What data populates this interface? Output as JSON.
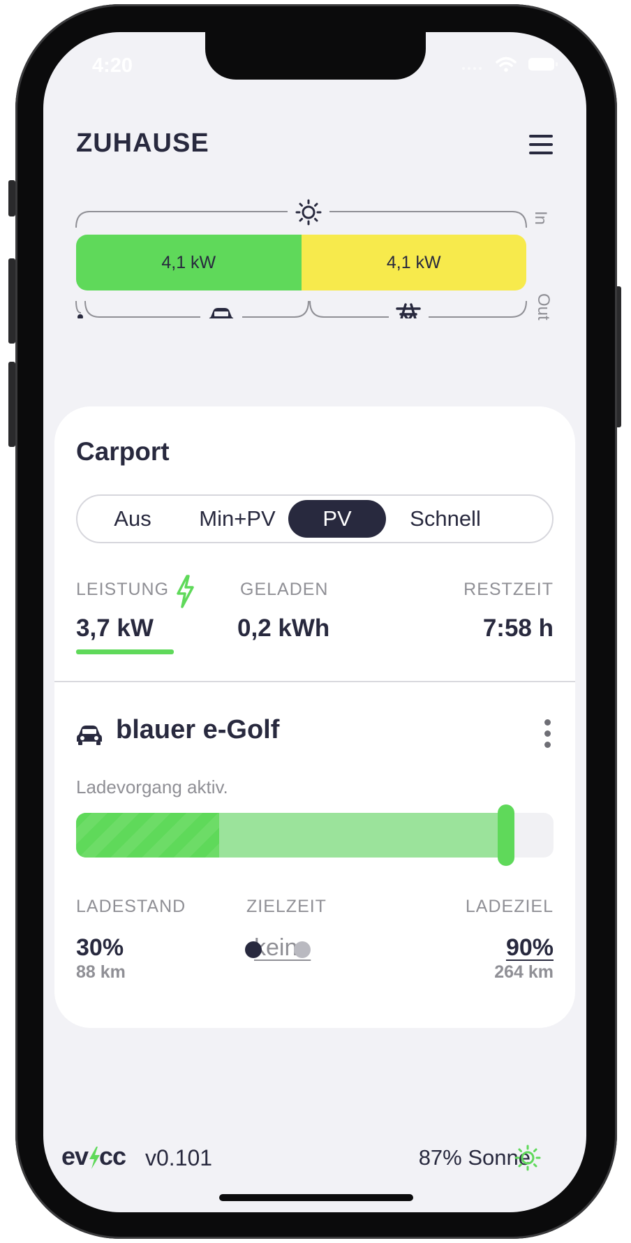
{
  "status_bar": {
    "time": "4:20"
  },
  "site": {
    "title": "ZUHAUSE"
  },
  "energy_flow": {
    "in_label": "In",
    "out_label": "Out",
    "segments": [
      {
        "value": "4,1 kW",
        "color": "#5fd95a",
        "share": 0.5
      },
      {
        "value": "4,1 kW",
        "color": "#f7ea4c",
        "share": 0.5
      }
    ],
    "source_icon": "sun-icon",
    "consumer_icons": [
      "house-dot-icon",
      "car-icon",
      "grid-tower-icon"
    ]
  },
  "loadpoint": {
    "title": "Carport",
    "modes": [
      "Aus",
      "Min+PV",
      "PV",
      "Schnell"
    ],
    "active_mode": "PV",
    "stats": {
      "power_label": "LEISTUNG",
      "power_value": "3,7 kW",
      "charged_label": "GELADEN",
      "charged_value": "0,2 kWh",
      "remaining_label": "RESTZEIT",
      "remaining_value": "7:58 h"
    },
    "charging_icon": "lightning-bolt-icon",
    "vehicle": {
      "icon": "car-icon",
      "name": "blauer e-Golf",
      "status": "Ladevorgang aktiv.",
      "soc_current_percent": 30,
      "soc_target_percent": 90,
      "soc_label": "LADESTAND",
      "soc_value": "30%",
      "soc_range": "88 km",
      "target_time_label": "ZIELZEIT",
      "target_time_value": "keine",
      "target_label": "LADEZIEL",
      "target_value": "90%",
      "target_range": "264 km"
    }
  },
  "pagination": {
    "pages": 2,
    "current": 1
  },
  "footer": {
    "logo": "evcc",
    "version": "v0.101",
    "solar": "87% Sonne"
  },
  "colors": {
    "primary": "#28293e",
    "green": "#5fd95a",
    "light_green": "#9be39b",
    "yellow": "#f7ea4c",
    "muted": "#8f8f95",
    "background": "#f2f2f6"
  }
}
